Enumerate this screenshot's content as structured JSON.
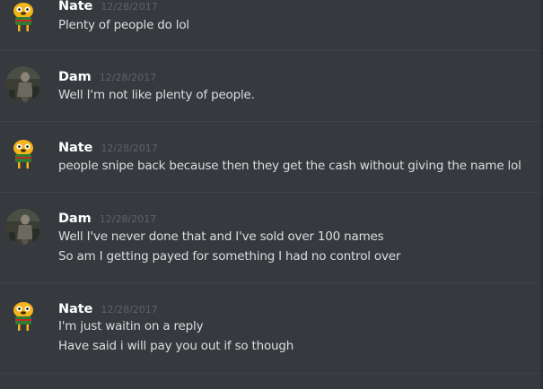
{
  "messages": [
    {
      "username": "Nate",
      "timestamp": "12/28/2017",
      "avatar_icon": "jake-avatar-icon",
      "lines": [
        "Plenty of people do lol"
      ]
    },
    {
      "username": "Dam",
      "timestamp": "12/28/2017",
      "avatar_icon": "dam-avatar-icon",
      "lines": [
        "Well I'm not like plenty of people."
      ]
    },
    {
      "username": "Nate",
      "timestamp": "12/28/2017",
      "avatar_icon": "jake-avatar-icon",
      "lines": [
        "people snipe back because then they get the cash without giving the name lol"
      ]
    },
    {
      "username": "Dam",
      "timestamp": "12/28/2017",
      "avatar_icon": "dam-avatar-icon",
      "lines": [
        "Well I've never done that and I've sold over 100 names",
        "So am I getting payed for something I had no control over"
      ]
    },
    {
      "username": "Nate",
      "timestamp": "12/28/2017",
      "avatar_icon": "jake-avatar-icon",
      "lines": [
        "I'm just waitin on a reply",
        "Have said i will pay you out if so though"
      ]
    }
  ],
  "colors": {
    "background": "#36393e",
    "username": "#ffffff",
    "message_text": "#dcddde",
    "timestamp": "#5f6166",
    "divider": "#3f4248"
  }
}
